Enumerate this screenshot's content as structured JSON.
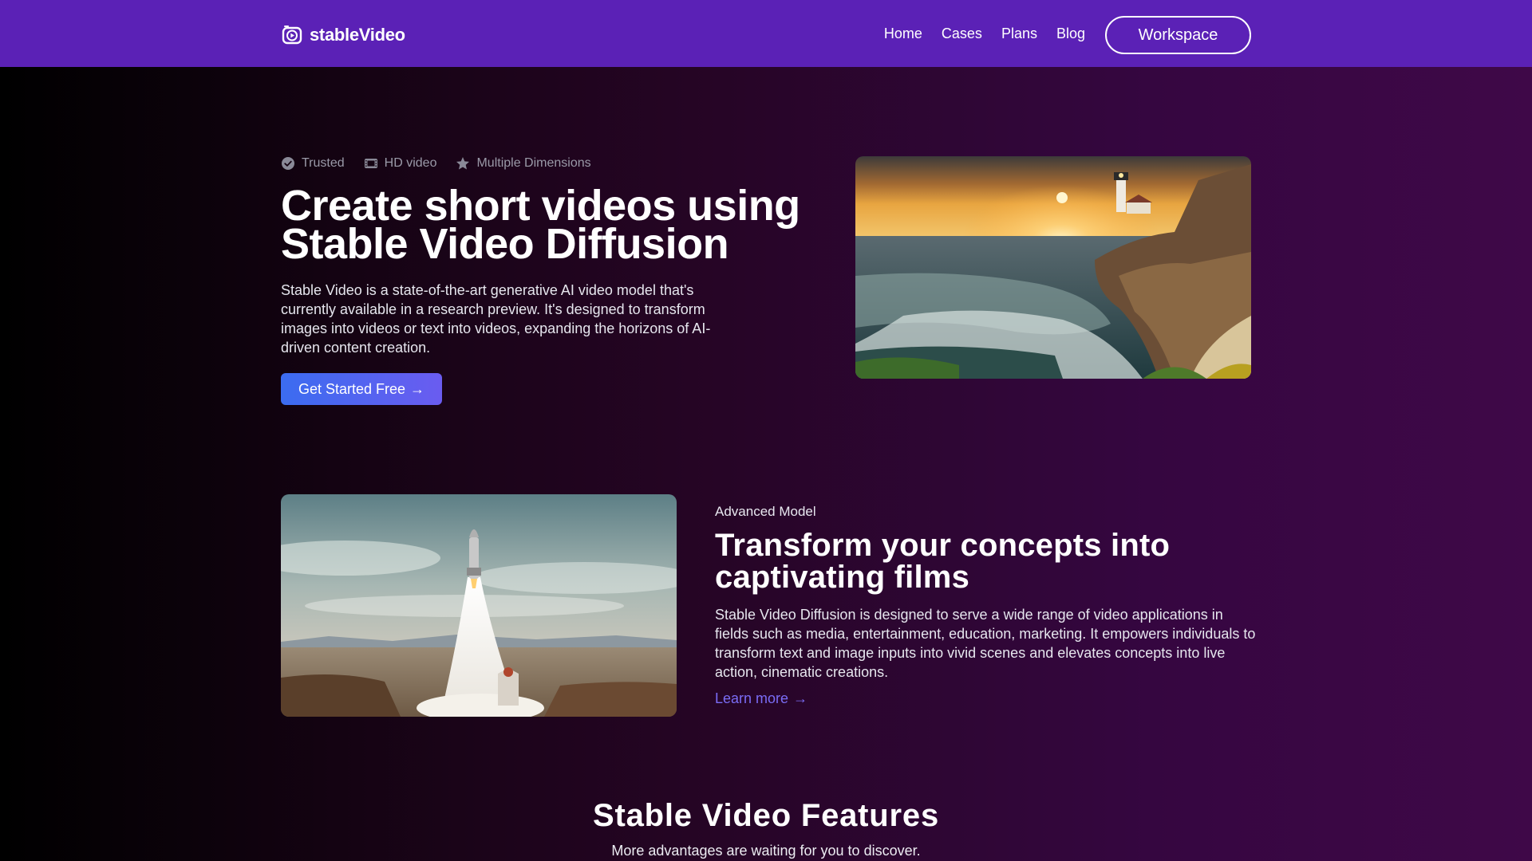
{
  "nav": {
    "brand": "stableVideo",
    "links": [
      "Home",
      "Cases",
      "Plans",
      "Blog"
    ],
    "workspace_label": "Workspace"
  },
  "hero": {
    "badges": [
      {
        "icon": "check-circle-icon",
        "label": "Trusted"
      },
      {
        "icon": "film-icon",
        "label": "HD video"
      },
      {
        "icon": "star-icon",
        "label": "Multiple Dimensions"
      }
    ],
    "title_line1": "Create short videos using",
    "title_line2": "Stable Video Diffusion",
    "description": "Stable Video is a state-of-the-art generative AI video model that's currently available in a research preview. It's designed to transform images into videos or text into videos, expanding the horizons of AI-driven content creation.",
    "cta_label": "Get Started Free",
    "cta_arrow": "→",
    "image": "lighthouse-coast-sunset"
  },
  "section2": {
    "eyebrow": "Advanced Model",
    "title_line1": "Transform your concepts into",
    "title_line2": "captivating films",
    "description": "Stable Video Diffusion is designed to serve a wide range of video applications in fields such as media, entertainment, education, marketing. It empowers individuals to transform text and image inputs into vivid scenes and elevates concepts into live action, cinematic creations.",
    "link_label": "Learn more",
    "link_arrow": "→",
    "image": "rocket-launch-desert"
  },
  "section3": {
    "title": "Stable Video Features",
    "subtitle": "More advantages are waiting for you to discover."
  },
  "colors": {
    "nav_bg": "#5b21b6",
    "cta_start": "#3b6cf0",
    "cta_end": "#6a5cf0",
    "link": "#7a6cf5",
    "badge_text": "#9a9aa8"
  }
}
